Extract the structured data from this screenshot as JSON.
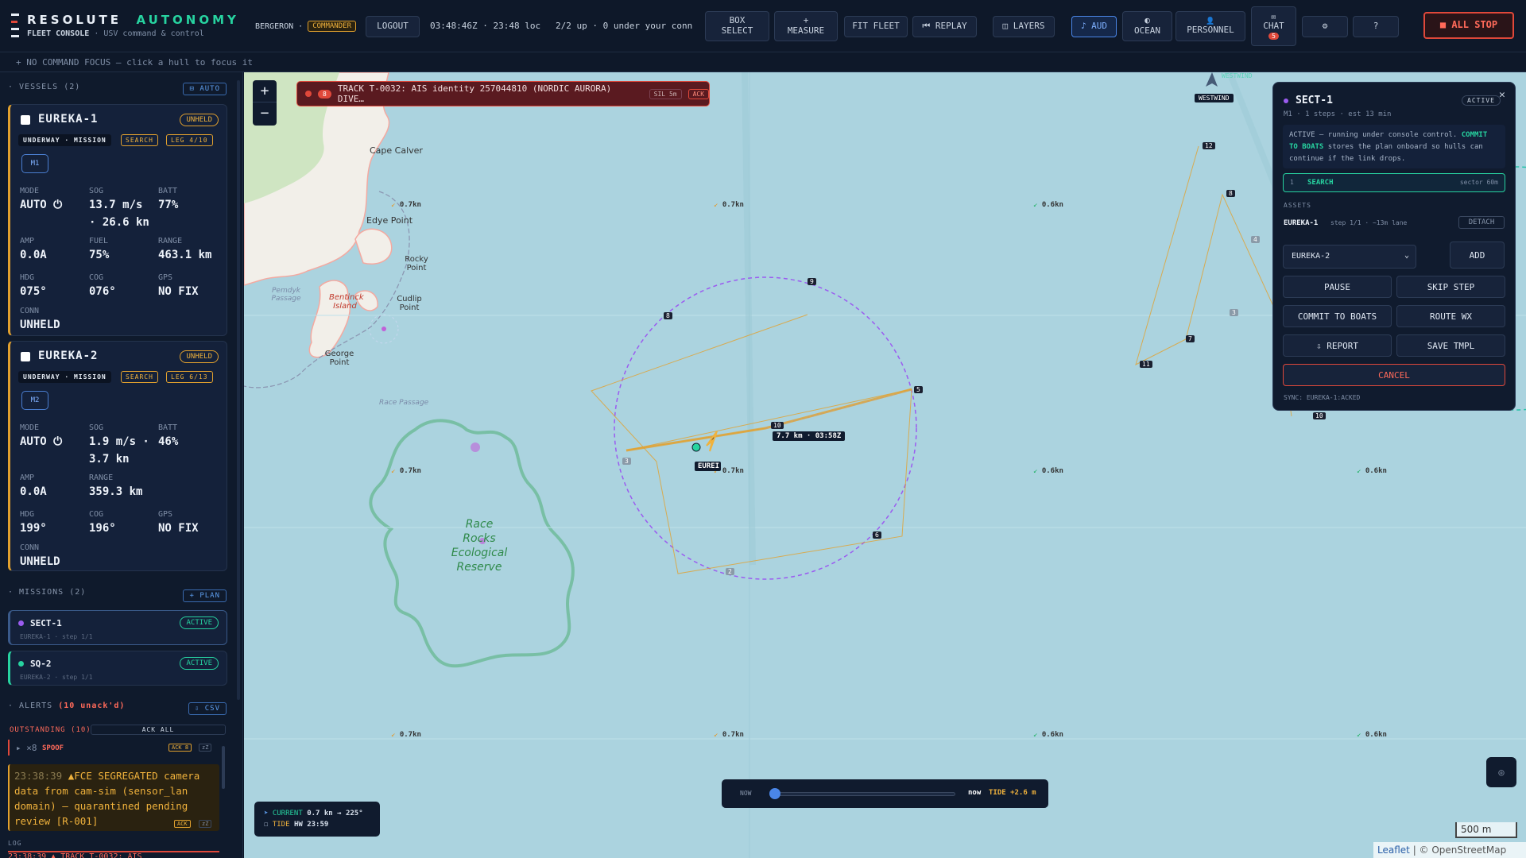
{
  "header": {
    "brand_a": "RESOLUTE",
    "brand_b": "AUTONOMY",
    "subtitle_a": "FLEET CONSOLE",
    "subtitle_b": "· USV command & control",
    "user": "BERGERON ·",
    "role": "COMMANDER",
    "logout": "LOGOUT",
    "clock": "03:48:46Z · 23:48 loc",
    "status": "2/2 up · 0 under your conn",
    "box_select_1": "BOX",
    "box_select_2": "SELECT",
    "measure_1": "+",
    "measure_2": "MEASURE",
    "fit_fleet": "FIT FLEET",
    "replay": "⏮ REPLAY",
    "layers": "◫ LAYERS",
    "aud": "♪ AUD",
    "ocean_1": "◐",
    "ocean_2": "OCEAN",
    "personnel_1": "👤",
    "personnel_2": "PERSONNEL",
    "chat_1": "✉",
    "chat_2": "CHAT",
    "chat_count": "5",
    "settings": "⚙",
    "help": "?",
    "all_stop": "■ ALL STOP"
  },
  "focus_bar": "+ NO COMMAND FOCUS — click a hull to focus it",
  "sidebar": {
    "vessels_header": "· VESSELS (2)",
    "auto_btn": "⊟ AUTO",
    "vessels": [
      {
        "name": "EUREKA-1",
        "conn_badge": "UNHELD",
        "state": "UNDERWAY · MISSION",
        "tag": "SEARCH",
        "leg": "LEG 4/10",
        "mission_chip": "M1",
        "labels": {
          "mode": "MODE",
          "sog": "SOG",
          "batt": "BATT",
          "amp": "AMP",
          "fuel": "FUEL",
          "range": "RANGE",
          "hdg": "HDG",
          "cog": "COG",
          "gps": "GPS",
          "conn": "CONN"
        },
        "mode": "AUTO ⏻",
        "sog_1": "13.7 m/s",
        "sog_2": "· 26.6 kn",
        "batt": "77%",
        "amp": "0.0A",
        "fuel": "75%",
        "range": "463.1 km",
        "hdg": "075°",
        "cog": "076°",
        "gps": "NO FIX",
        "conn": "UNHELD"
      },
      {
        "name": "EUREKA-2",
        "conn_badge": "UNHELD",
        "state": "UNDERWAY · MISSION",
        "tag": "SEARCH",
        "leg": "LEG 6/13",
        "mission_chip": "M2",
        "labels": {
          "mode": "MODE",
          "sog": "SOG",
          "batt": "BATT",
          "amp": "AMP",
          "range": "RANGE",
          "hdg": "HDG",
          "cog": "COG",
          "gps": "GPS",
          "conn": "CONN"
        },
        "mode": "AUTO ⏻",
        "sog_1": "1.9 m/s ·",
        "sog_2": "3.7 kn",
        "batt": "46%",
        "amp": "0.0A",
        "range": "359.3 km",
        "hdg": "199°",
        "cog": "196°",
        "gps": "NO FIX",
        "conn": "UNHELD"
      }
    ],
    "missions_header": "· MISSIONS (2)",
    "plan_btn": "+ PLAN",
    "missions": [
      {
        "name": "SECT-1",
        "sub": "EUREKA-1 · step 1/1",
        "status": "ACTIVE",
        "color": "#9b5cf0"
      },
      {
        "name": "SQ-2",
        "sub": "EUREKA-2 · step 1/1",
        "status": "ACTIVE",
        "color": "#27d3a0"
      }
    ],
    "alerts_header_a": "· ALERTS",
    "alerts_header_b": "(10 unack'd)",
    "csv_btn": "⇩ CSV",
    "outstanding": "OUTSTANDING (10)",
    "ack_all": "ACK ALL",
    "spoof_group": "▸ ×8",
    "spoof_label": "SPOOF",
    "spoof_ack": "ACK 8",
    "spoof_z": "zZ",
    "alert_time": "23:38:39",
    "alert_text": "▲FCE SEGREGATED camera data from cam-sim (sensor_lan domain) — quarantined pending review [R-001]",
    "alert_ack": "ACK",
    "alert_z": "zZ",
    "log_header": "LOG",
    "log_line": "23:38:39 ▲ TRACK T-0032: AIS"
  },
  "map": {
    "banner_count": "8",
    "banner_text": "TRACK T-0032: AIS identity 257044810 (NORDIC AURORA) DIVE…",
    "banner_sil": "SIL 5m",
    "banner_ack": "ACK",
    "zoom_in": "+",
    "zoom_out": "−",
    "places": [
      "Cape Calver",
      "Edye Point",
      "Rocky Point",
      "Bentinck Island",
      "Cudlip Point",
      "George Point",
      "Pemdyk Passage",
      "Race Passage",
      "Race Rocks Ecological Reserve"
    ],
    "currents": [
      "0.7kn",
      "0.7kn",
      "0.6kn",
      "0.7kn",
      "0.7kn",
      "0.6kn",
      "0.6kn",
      "0.7kn",
      "0.7kn",
      "0.6kn",
      "0.6kn"
    ],
    "vessel_label": "EUREI",
    "distance_label": "7.7 km · 03:58Z",
    "westwind": "WESTWIND",
    "westwind_faint": "WESTWIND",
    "wp_sect": [
      "9",
      "8",
      "5",
      "10",
      "3",
      "6",
      "2"
    ],
    "wp_sq": [
      "12",
      "8",
      "4",
      "3",
      "7",
      "11",
      "10"
    ],
    "legend_current_label": "CURRENT",
    "legend_current_value": "0.7 kn → 225°",
    "legend_tide_label": "TIDE",
    "legend_tide_value": "HW 23:59",
    "timeline_now": "NOW",
    "timeline_end": "now",
    "timeline_tide": "TIDE +2.6 m",
    "scale": "500 m",
    "attribution_a": "Leaflet",
    "attribution_b": "| © OpenStreetMap"
  },
  "mission_panel": {
    "name": "SECT-1",
    "status": "ACTIVE",
    "sub": "M1 · 1 steps · est 13 min",
    "info_a": "ACTIVE — running under console control.",
    "info_b": "COMMIT TO BOATS",
    "info_c": "stores the plan onboard so hulls can continue if the link drops.",
    "step_num": "1",
    "step_name": "SEARCH",
    "step_detail": "sector 60m",
    "assets_label": "ASSETS",
    "asset_name": "EUREKA-1",
    "asset_detail": "step 1/1 · ~13m lane",
    "detach": "DETACH",
    "select_value": "EUREKA-2",
    "add": "ADD",
    "pause": "PAUSE",
    "skip": "SKIP STEP",
    "commit": "COMMIT TO BOATS",
    "route_wx": "ROUTE WX",
    "report": "⇩ REPORT",
    "save_tmpl": "SAVE TMPL",
    "cancel": "CANCEL",
    "sync": "SYNC: EUREKA-1:ACKED",
    "close": "✕"
  }
}
